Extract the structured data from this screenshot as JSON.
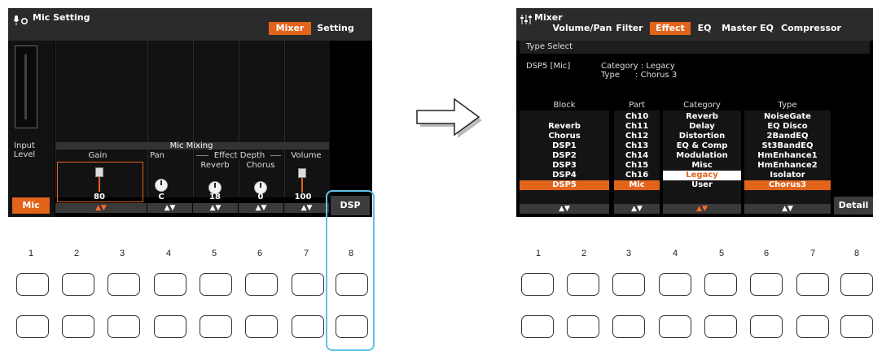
{
  "left_screen": {
    "title": "Mic Setting",
    "tabs": [
      {
        "label": "Mixer",
        "active": true
      },
      {
        "label": "Setting",
        "active": false
      }
    ],
    "input_level_label": [
      "Input",
      "Level"
    ],
    "mic_mixing_label": "Mic Mixing",
    "effect_depth_label": "Effect Depth",
    "params": {
      "gain": {
        "label": "Gain",
        "value": "80"
      },
      "pan": {
        "label": "Pan",
        "value": "C"
      },
      "reverb": {
        "label": "Reverb",
        "value": "18"
      },
      "chorus": {
        "label": "Chorus",
        "value": "0"
      },
      "volume": {
        "label": "Volume",
        "value": "100"
      }
    },
    "arrow_glyph": "▲▼",
    "mic_button": "Mic",
    "dsp_button": "DSP"
  },
  "right_screen": {
    "title": "Mixer",
    "tabs": [
      {
        "label": "Volume/Pan",
        "active": false
      },
      {
        "label": "Filter",
        "active": false
      },
      {
        "label": "Effect",
        "active": true
      },
      {
        "label": "EQ",
        "active": false
      },
      {
        "label": "Master EQ",
        "active": false
      },
      {
        "label": "Compressor",
        "active": false
      }
    ],
    "type_select_label": "Type Select",
    "dsp_name": "DSP5 [Mic]",
    "category_line": "Category : Legacy",
    "type_line": "Type      : Chorus 3",
    "columns": {
      "block": {
        "header": "Block",
        "items": [
          "",
          "Reverb",
          "Chorus",
          "DSP1",
          "DSP2",
          "DSP3",
          "DSP4",
          "DSP5"
        ],
        "selected": 7
      },
      "part": {
        "header": "Part",
        "items": [
          "Ch10",
          "Ch11",
          "Ch12",
          "Ch13",
          "Ch14",
          "Ch15",
          "Ch16",
          "Mic"
        ],
        "selected": 7
      },
      "category": {
        "header": "Category",
        "items": [
          "Reverb",
          "Delay",
          "Distortion",
          "EQ & Comp",
          "Modulation",
          "Misc",
          "Legacy",
          "User"
        ],
        "selected": 6
      },
      "type": {
        "header": "Type",
        "items": [
          "NoiseGate",
          "EQ Disco",
          "2BandEQ",
          "St3BandEQ",
          "HmEnhance1",
          "HmEnhance2",
          "Isolator",
          "Chorus3"
        ],
        "selected": 7
      }
    },
    "arrow_glyph": "▲▼",
    "detail_button": "Detail"
  },
  "panel_numbers": [
    "1",
    "2",
    "3",
    "4",
    "5",
    "6",
    "7",
    "8"
  ],
  "colors": {
    "accent": "#e2641b",
    "highlight": "#5fc3e8"
  }
}
